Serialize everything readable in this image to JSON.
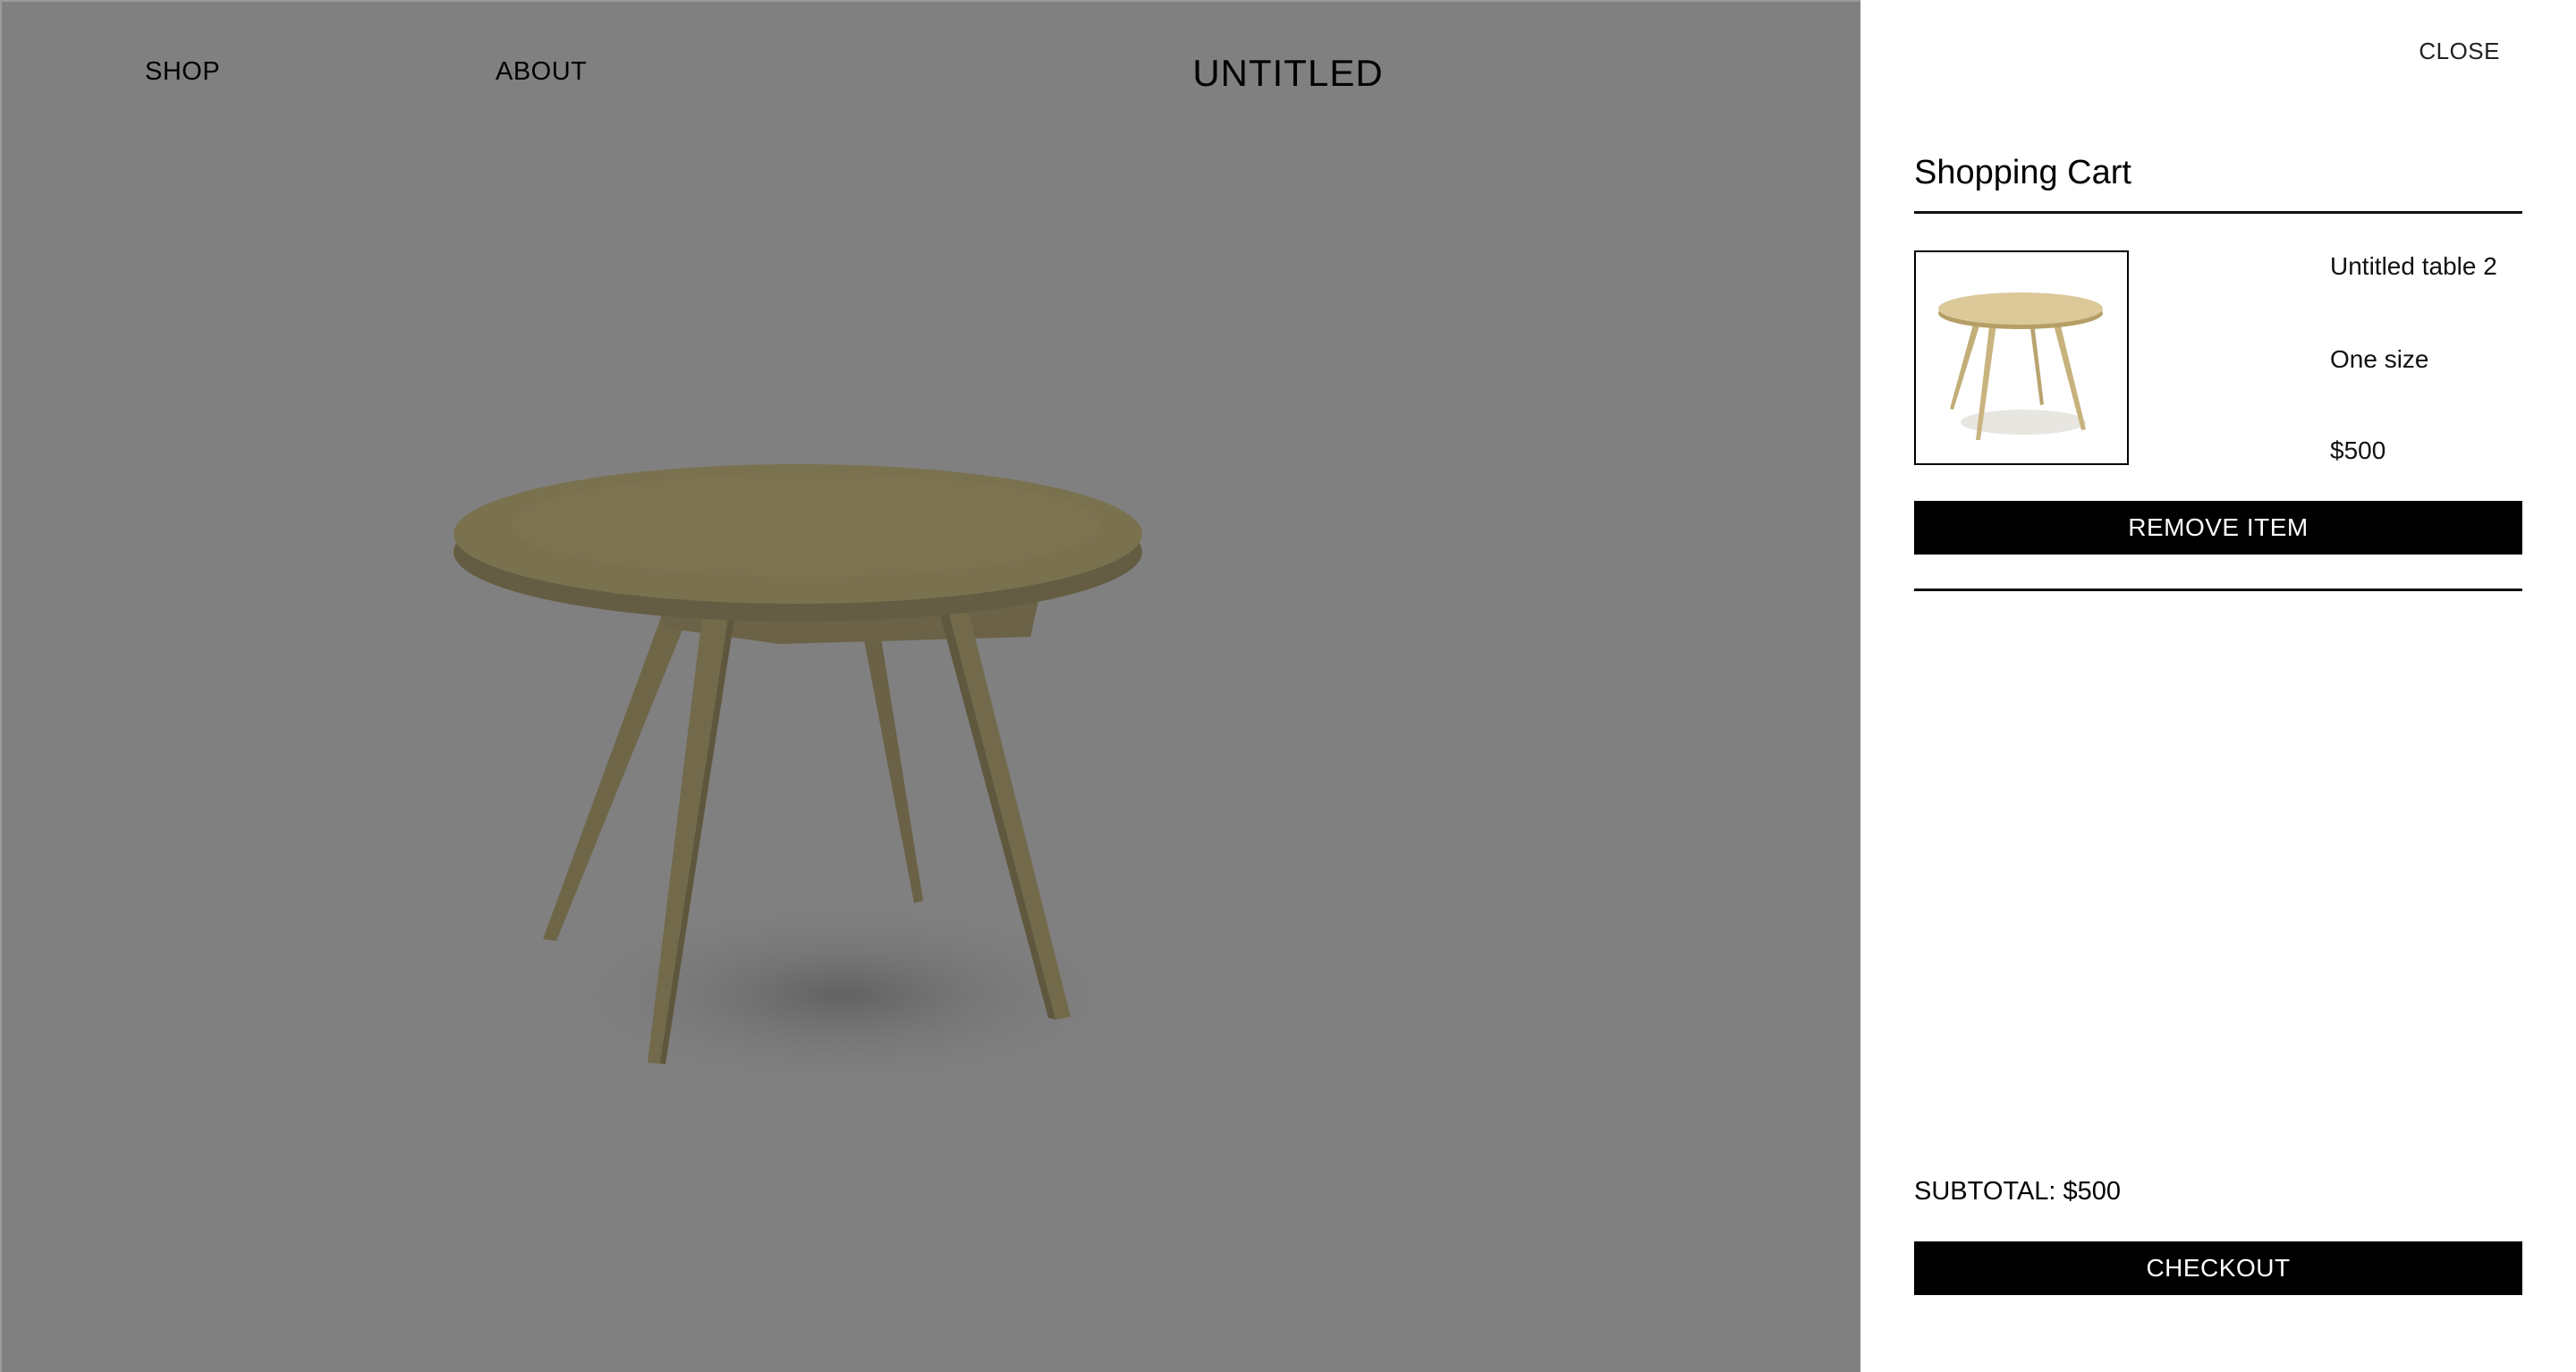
{
  "nav": {
    "shop_label": "SHOP",
    "about_label": "ABOUT",
    "brand": "UNTITLED"
  },
  "hero": {
    "image": "wooden-round-table",
    "overlay_color": "#808080"
  },
  "cart": {
    "close_label": "CLOSE",
    "title": "Shopping Cart",
    "items": [
      {
        "name": "Untitled table 2",
        "size": "One size",
        "price": "$500",
        "thumbnail": "wooden-round-table",
        "remove_label": "REMOVE ITEM"
      }
    ],
    "subtotal_label": "SUBTOTAL: $500",
    "checkout_label": "CHECKOUT"
  },
  "colors": {
    "button_bg": "#000000",
    "button_text": "#ffffff",
    "drawer_bg": "#ffffff"
  }
}
